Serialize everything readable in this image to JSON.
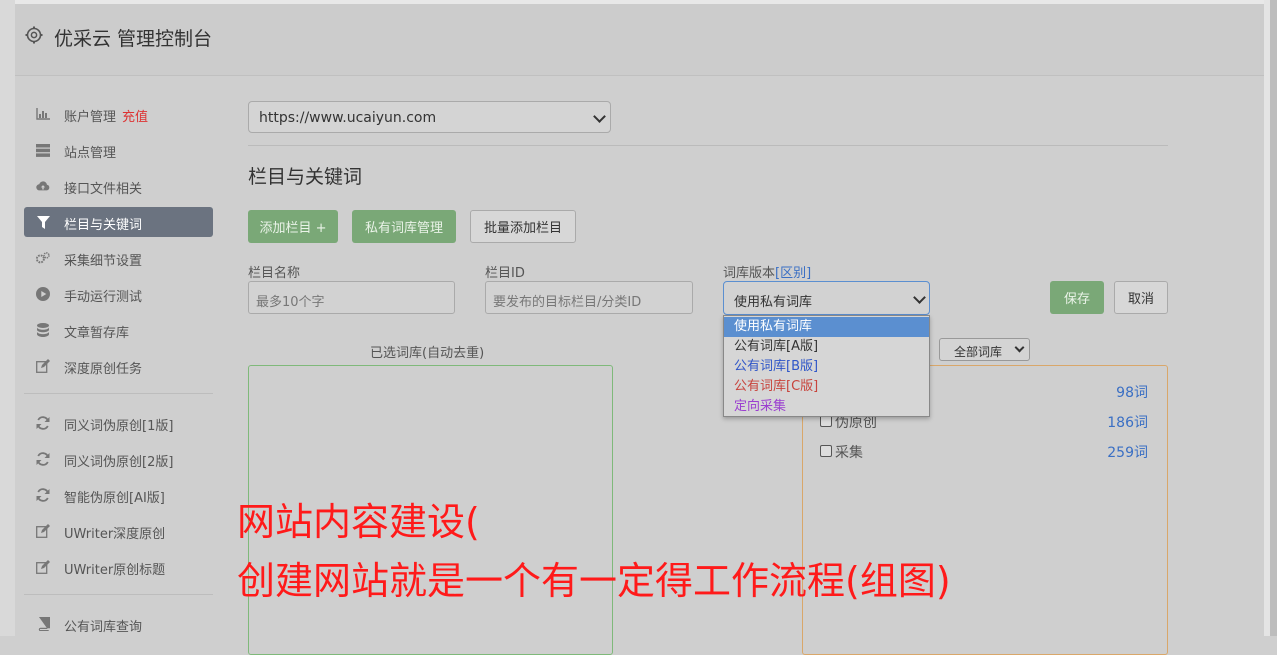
{
  "header": {
    "title": "优采云 管理控制台"
  },
  "sidebar": {
    "items": [
      {
        "label": "账户管理",
        "badge": "充值",
        "icon": "bar-chart-icon"
      },
      {
        "label": "站点管理",
        "icon": "server-icon"
      },
      {
        "label": "接口文件相关",
        "icon": "cloud-upload-icon"
      },
      {
        "label": "栏目与关键词",
        "icon": "filter-icon",
        "active": true
      },
      {
        "label": "采集细节设置",
        "icon": "gears-icon"
      },
      {
        "label": "手动运行测试",
        "icon": "play-circle-icon"
      },
      {
        "label": "文章暂存库",
        "icon": "database-icon"
      },
      {
        "label": "深度原创任务",
        "icon": "edit-icon"
      },
      {
        "label": "同义词伪原创[1版]",
        "icon": "refresh-icon"
      },
      {
        "label": "同义词伪原创[2版]",
        "icon": "refresh-icon"
      },
      {
        "label": "智能伪原创[AI版]",
        "icon": "refresh-icon"
      },
      {
        "label": "UWriter深度原创",
        "icon": "edit-icon"
      },
      {
        "label": "UWriter原创标题",
        "icon": "edit-icon"
      },
      {
        "label": "公有词库查询",
        "icon": "book-icon"
      }
    ]
  },
  "site_select": {
    "value": "https://www.ucaiyun.com"
  },
  "section_title": "栏目与关键词",
  "buttons": {
    "add_column": "添加栏目 +",
    "private_lib": "私有词库管理",
    "batch_add": "批量添加栏目",
    "save": "保存",
    "cancel": "取消"
  },
  "form": {
    "column_name_label": "栏目名称",
    "column_name_placeholder": "最多10个字",
    "column_id_label": "栏目ID",
    "column_id_placeholder": "要发布的目标栏目/分类ID",
    "version_label": "词库版本",
    "version_link": "[区别]",
    "version_value": "使用私有词库"
  },
  "version_options": [
    {
      "label": "使用私有词库",
      "color": "#ffffff",
      "selected": true
    },
    {
      "label": "公有词库[A版]",
      "color": "#333333"
    },
    {
      "label": "公有词库[B版]",
      "color": "#2f56c8"
    },
    {
      "label": "公有词库[C版]",
      "color": "#c8443c"
    },
    {
      "label": "定向采集",
      "color": "#9b3fd0"
    }
  ],
  "selected_box_label": "已选词库(自动去重)",
  "lib_filter": {
    "value": "全部词库"
  },
  "libraries": [
    {
      "name": "",
      "count": "98词"
    },
    {
      "name": "伪原创",
      "count": "186词"
    },
    {
      "name": "采集",
      "count": "259词"
    }
  ],
  "overlay": {
    "line1": "网站内容建设(",
    "line2": "创建网站就是一个有一定得工作流程(组图)"
  },
  "colors": {
    "accent_green": "#7aa877",
    "active_nav": "#6b7380",
    "link_blue": "#3a6fc4",
    "overlay_red": "#ff1a1a"
  }
}
